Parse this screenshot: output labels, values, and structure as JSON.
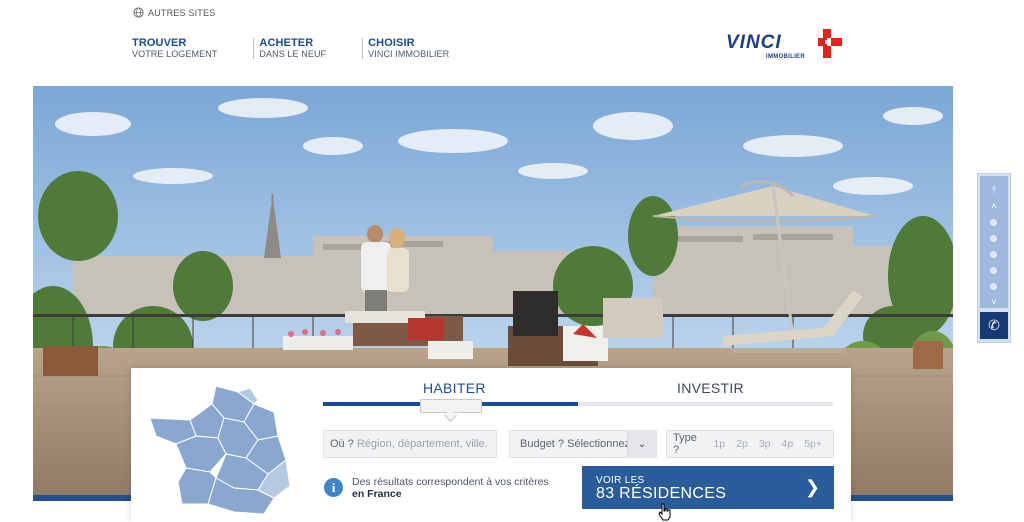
{
  "topbar": {
    "autres_sites": "AUTRES SITES"
  },
  "nav": [
    {
      "title": "TROUVER",
      "sub": "VOTRE LOGEMENT"
    },
    {
      "title": "ACHETER",
      "sub": "DANS LE NEUF"
    },
    {
      "title": "CHOISIR",
      "sub": "VINCI IMMOBILIER"
    }
  ],
  "logo": {
    "brand": "VINCI",
    "sub": "IMMOBILIER",
    "colors": {
      "blue": "#1d3f8a",
      "red": "#e2231a"
    }
  },
  "sidenav": {
    "icons": [
      "first-icon",
      "up-icon",
      "down-icon",
      "phone-icon"
    ],
    "dots": 5
  },
  "search": {
    "tabs": {
      "habiter": "HABITER",
      "investir": "INVESTIR"
    },
    "where": {
      "label": "Où ?",
      "placeholder": "Région, département, ville..."
    },
    "budget": {
      "label": "Budget ?",
      "value": "Sélectionnez"
    },
    "type": {
      "label": "Type ?",
      "options": [
        "1p",
        "2p",
        "3p",
        "4p",
        "5p+"
      ]
    },
    "info": {
      "line1": "Des résultats correspondent à vos critères",
      "line2": "en France"
    },
    "cta": {
      "line1": "VOIR LES",
      "line2": "83 RÉSIDENCES"
    }
  },
  "colors": {
    "accent": "#1d4b8f",
    "cta": "#2b5c9a",
    "sidenav": "#9fb8dd"
  }
}
